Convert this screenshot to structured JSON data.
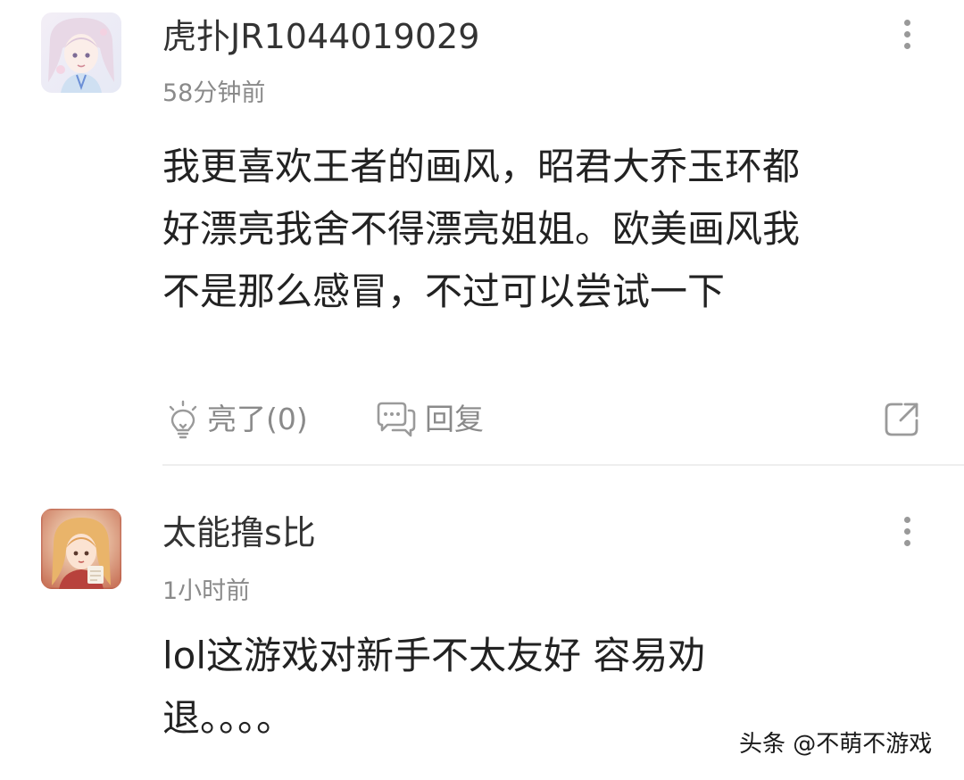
{
  "comments": [
    {
      "username": "虎扑JR1044019029",
      "time": "58分钟前",
      "content_lines": [
        "我更喜欢王者的画风，昭君大乔玉环都",
        "好漂亮我舍不得漂亮姐姐。欧美画风我",
        "不是那么感冒，不过可以尝试一下"
      ],
      "avatar_icon": "anime-girl-avatar-icon",
      "actions": {
        "like_label": "亮了(0)",
        "reply_label": "回复",
        "like_icon": "lightbulb-icon",
        "reply_icon": "chat-bubble-icon",
        "share_icon": "share-icon"
      }
    },
    {
      "username": "太能撸s比",
      "time": "1小时前",
      "content_lines": [
        "lol这游戏对新手不太友好 容易劝",
        "退。。。。"
      ],
      "avatar_icon": "anime-girl-avatar-icon"
    }
  ],
  "watermark": "头条 @不萌不游戏",
  "colors": {
    "text_primary": "#222222",
    "text_secondary": "#8a8a8a",
    "divider": "#eeeeee",
    "background": "#ffffff"
  }
}
